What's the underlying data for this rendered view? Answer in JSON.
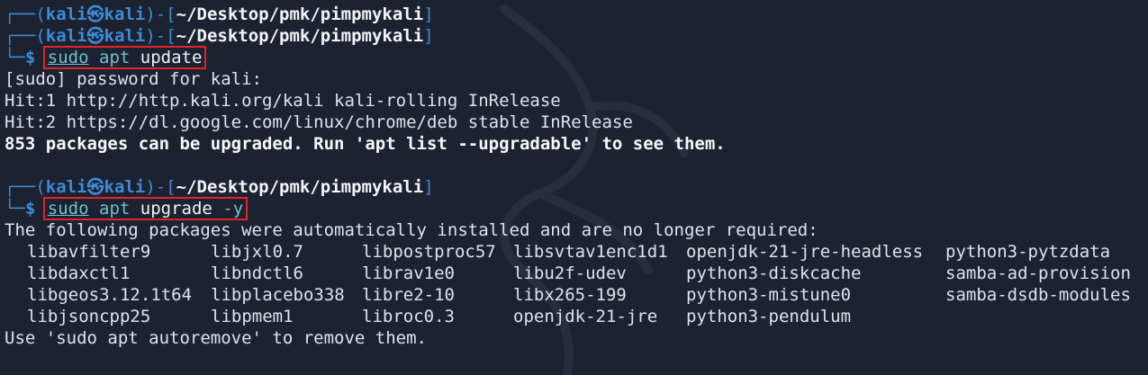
{
  "prompt": {
    "user": "kali",
    "at_symbol": "㉿",
    "host": "kali",
    "path": "~/Desktop/pmk/pimpmykali"
  },
  "commands": {
    "update": {
      "sudo": "sudo",
      "apt": "apt",
      "arg": "update"
    },
    "upgrade": {
      "sudo": "sudo",
      "apt": "apt",
      "arg": "upgrade",
      "flag": "-y"
    }
  },
  "update_output": [
    "[sudo] password for kali:",
    "Hit:1 http://http.kali.org/kali kali-rolling InRelease",
    "Hit:2 https://dl.google.com/linux/chrome/deb stable InRelease"
  ],
  "update_summary": "853 packages can be upgraded. Run 'apt list --upgradable' to see them.",
  "upgrade_intro": "The following packages were automatically installed and are no longer required:",
  "packages": [
    [
      "libavfilter9",
      "libjxl0.7",
      "libpostproc57",
      "libsvtav1enc1d1",
      "openjdk-21-jre-headless",
      "python3-pytzdata"
    ],
    [
      "libdaxctl1",
      "libndctl6",
      "librav1e0",
      "libu2f-udev",
      "python3-diskcache",
      "samba-ad-provision"
    ],
    [
      "libgeos3.12.1t64",
      "libplacebo338",
      "libre2-10",
      "libx265-199",
      "python3-mistune0",
      "samba-dsdb-modules"
    ],
    [
      "libjsoncpp25",
      "libpmem1",
      "libroc0.3",
      "openjdk-21-jre",
      "python3-pendulum",
      ""
    ]
  ],
  "autoremove_hint": "Use 'sudo apt autoremove' to remove them.",
  "colors": {
    "background": "#1c2230",
    "prompt_blue": "#3d8bd8",
    "command_cyan": "#6ec3cc",
    "highlight_red": "#e0242a"
  }
}
